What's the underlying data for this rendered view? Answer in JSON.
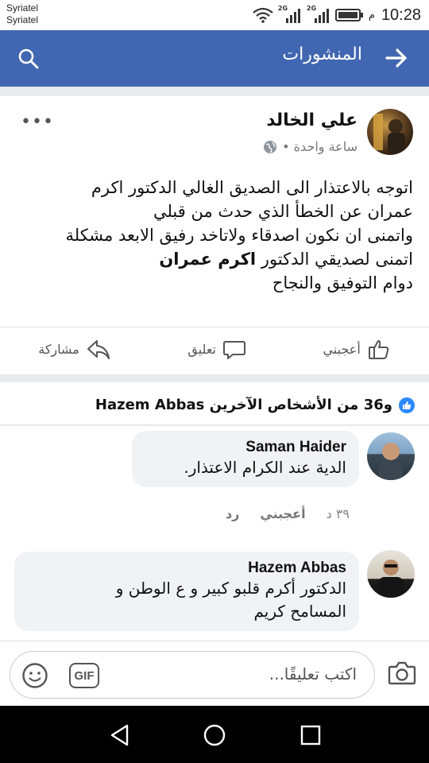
{
  "status": {
    "carrier1": "Syriatel",
    "carrier2": "Syriatel",
    "time": "10:28",
    "ampm": "م",
    "net1": "2G",
    "net2": "2G"
  },
  "appbar": {
    "title": "المنشورات"
  },
  "post": {
    "author": "علي الخالد",
    "time": "ساعة واحدة •",
    "text_part1": "اتوجه بالاعتذار الى الصديق الغالي الدكتور اكرم\nعمران عن الخطأ الذي حدث من قبلي\nواتمنى ان نكون اصدقاء ولاتاخد رفيق الابعد مشكلة\nاتمنى لصديقي الدكتور",
    "text_bold": "اكرم عمران",
    "text_part2": "دوام التوفيق والنجاح",
    "like_label": "أعجبني",
    "comment_label": "تعليق",
    "share_label": "مشاركة"
  },
  "likes": {
    "summary": "و36 من الأشخاص الآخرين Hazem Abbas"
  },
  "comments": [
    {
      "name": "Saman Haider",
      "text": "الدية عند الكرام الاعتذار.",
      "time": "٣٩ د",
      "like": "أعجبني",
      "reply": "رد"
    },
    {
      "name": "Hazem Abbas",
      "text": "الدكتور أكرم قلبو كبير و ع الوطن و\nالمسامح كريم"
    }
  ],
  "composer": {
    "placeholder": "اكتب تعليقًا...",
    "gif": "GIF"
  }
}
